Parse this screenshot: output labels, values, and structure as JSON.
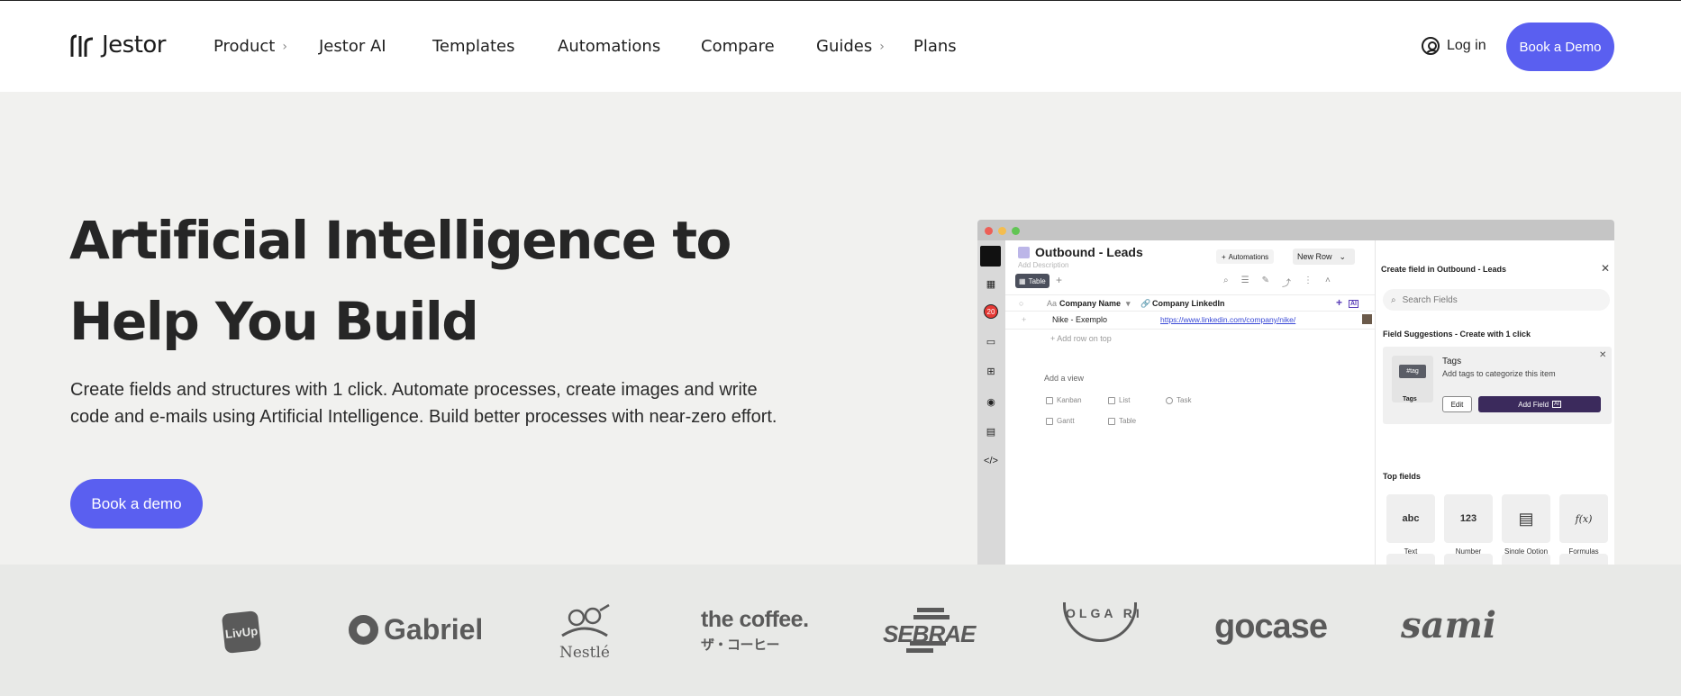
{
  "header": {
    "logo_text": "Jestor",
    "nav": [
      {
        "label": "Product",
        "has_chevron": true
      },
      {
        "label": "Jestor AI",
        "has_chevron": false
      },
      {
        "label": "Templates",
        "has_chevron": false
      },
      {
        "label": "Automations",
        "has_chevron": false
      },
      {
        "label": "Compare",
        "has_chevron": false
      },
      {
        "label": "Guides",
        "has_chevron": true
      },
      {
        "label": "Plans",
        "has_chevron": false
      }
    ],
    "login_label": "Log in",
    "cta_label": "Book a Demo"
  },
  "hero": {
    "title": "Artificial Intelligence to Help You Build",
    "subtitle": "Create fields and structures with 1 click. Automate processes, create images and write code and e-mails using Artificial Intelligence. Build better processes with near-zero effort.",
    "cta_label": "Book a demo"
  },
  "app": {
    "table_title": "Outbound - Leads",
    "add_description": "Add Description",
    "automations_btn": "Automations",
    "new_row_btn": "New Row",
    "view_tab": "Table",
    "sidebar_badge": "20",
    "columns": [
      "Company Name",
      "Company LinkedIn"
    ],
    "rows": [
      {
        "company": "Nike - Exemplo",
        "linkedin": "https://www.linkedin.com/company/nike/"
      }
    ],
    "add_row_label": "Add row on top",
    "add_view_label": "Add a view",
    "view_options": [
      "Kanban",
      "List",
      "Task",
      "Gantt",
      "Table"
    ],
    "panel": {
      "title": "Create field in Outbound - Leads",
      "search_placeholder": "Search Fields",
      "suggestions_title": "Field Suggestions - Create with 1 click",
      "suggestion": {
        "chip": "#tag",
        "chip_label": "Tags",
        "title": "Tags",
        "description": "Add tags to categorize this item",
        "edit_label": "Edit",
        "add_label": "Add Field"
      },
      "top_fields_title": "Top fields",
      "top_fields": [
        {
          "icon_text": "abc",
          "label": "Text"
        },
        {
          "icon_text": "123",
          "label": "Number"
        },
        {
          "icon_text": "",
          "label": "Single Option"
        },
        {
          "icon_text": "f(x)",
          "label": "Formulas"
        }
      ]
    }
  },
  "logos": [
    "LivUp",
    "Gabriel",
    "Nestlé",
    "the coffee.",
    "ザ・コーヒー",
    "SEBRAE",
    "OLGA RI",
    "gocase",
    "sami"
  ],
  "colors": {
    "accent": "#5a5ff0",
    "hero_bg": "#f1f1ef",
    "strip_bg": "#e8e9e7"
  }
}
